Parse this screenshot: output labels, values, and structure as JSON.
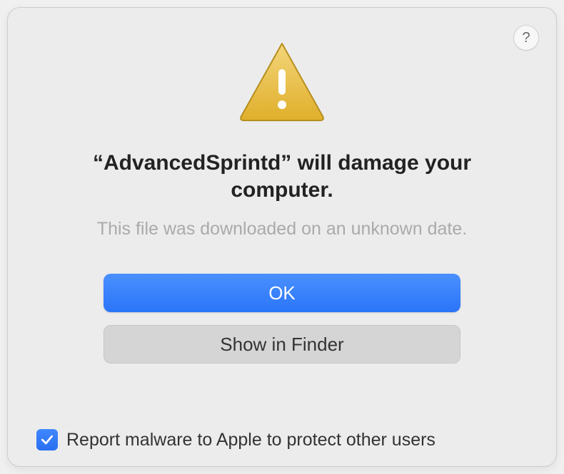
{
  "dialog": {
    "title": "“AdvancedSprintd” will damage your computer.",
    "subtitle": "This file was downloaded on an unknown date.",
    "primary_button_label": "OK",
    "secondary_button_label": "Show in Finder",
    "help_label": "?",
    "checkbox_label": "Report malware to Apple to protect other users",
    "checkbox_checked": true
  },
  "icon": {
    "name": "warning-triangle",
    "fill": "#E2B93B",
    "border": "#B68F1F"
  },
  "colors": {
    "primary_button": "#2A75F8",
    "secondary_button": "#D5D5D5",
    "checkbox": "#2A6FF0",
    "background": "#ECECEC"
  }
}
